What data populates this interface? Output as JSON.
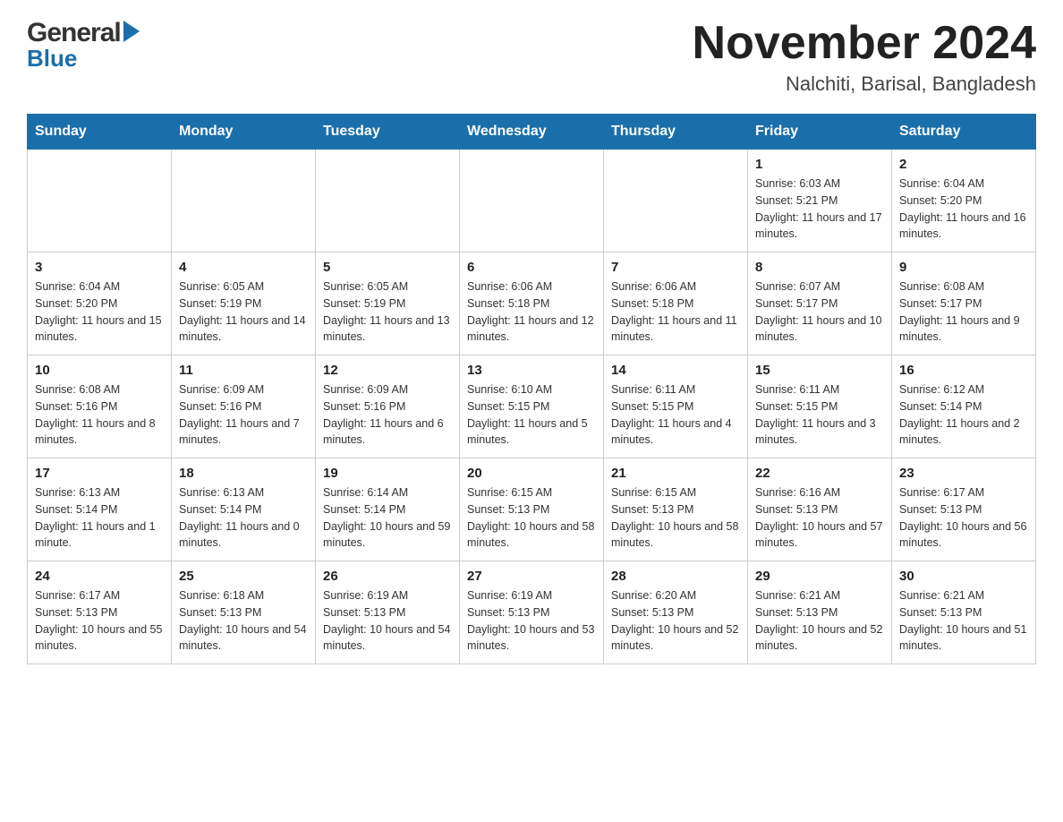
{
  "header": {
    "logo_general": "General",
    "logo_blue": "Blue",
    "month_year": "November 2024",
    "location": "Nalchiti, Barisal, Bangladesh"
  },
  "days_of_week": [
    "Sunday",
    "Monday",
    "Tuesday",
    "Wednesday",
    "Thursday",
    "Friday",
    "Saturday"
  ],
  "weeks": [
    [
      {
        "day": "",
        "sunrise": "",
        "sunset": "",
        "daylight": ""
      },
      {
        "day": "",
        "sunrise": "",
        "sunset": "",
        "daylight": ""
      },
      {
        "day": "",
        "sunrise": "",
        "sunset": "",
        "daylight": ""
      },
      {
        "day": "",
        "sunrise": "",
        "sunset": "",
        "daylight": ""
      },
      {
        "day": "",
        "sunrise": "",
        "sunset": "",
        "daylight": ""
      },
      {
        "day": "1",
        "sunrise": "Sunrise: 6:03 AM",
        "sunset": "Sunset: 5:21 PM",
        "daylight": "Daylight: 11 hours and 17 minutes."
      },
      {
        "day": "2",
        "sunrise": "Sunrise: 6:04 AM",
        "sunset": "Sunset: 5:20 PM",
        "daylight": "Daylight: 11 hours and 16 minutes."
      }
    ],
    [
      {
        "day": "3",
        "sunrise": "Sunrise: 6:04 AM",
        "sunset": "Sunset: 5:20 PM",
        "daylight": "Daylight: 11 hours and 15 minutes."
      },
      {
        "day": "4",
        "sunrise": "Sunrise: 6:05 AM",
        "sunset": "Sunset: 5:19 PM",
        "daylight": "Daylight: 11 hours and 14 minutes."
      },
      {
        "day": "5",
        "sunrise": "Sunrise: 6:05 AM",
        "sunset": "Sunset: 5:19 PM",
        "daylight": "Daylight: 11 hours and 13 minutes."
      },
      {
        "day": "6",
        "sunrise": "Sunrise: 6:06 AM",
        "sunset": "Sunset: 5:18 PM",
        "daylight": "Daylight: 11 hours and 12 minutes."
      },
      {
        "day": "7",
        "sunrise": "Sunrise: 6:06 AM",
        "sunset": "Sunset: 5:18 PM",
        "daylight": "Daylight: 11 hours and 11 minutes."
      },
      {
        "day": "8",
        "sunrise": "Sunrise: 6:07 AM",
        "sunset": "Sunset: 5:17 PM",
        "daylight": "Daylight: 11 hours and 10 minutes."
      },
      {
        "day": "9",
        "sunrise": "Sunrise: 6:08 AM",
        "sunset": "Sunset: 5:17 PM",
        "daylight": "Daylight: 11 hours and 9 minutes."
      }
    ],
    [
      {
        "day": "10",
        "sunrise": "Sunrise: 6:08 AM",
        "sunset": "Sunset: 5:16 PM",
        "daylight": "Daylight: 11 hours and 8 minutes."
      },
      {
        "day": "11",
        "sunrise": "Sunrise: 6:09 AM",
        "sunset": "Sunset: 5:16 PM",
        "daylight": "Daylight: 11 hours and 7 minutes."
      },
      {
        "day": "12",
        "sunrise": "Sunrise: 6:09 AM",
        "sunset": "Sunset: 5:16 PM",
        "daylight": "Daylight: 11 hours and 6 minutes."
      },
      {
        "day": "13",
        "sunrise": "Sunrise: 6:10 AM",
        "sunset": "Sunset: 5:15 PM",
        "daylight": "Daylight: 11 hours and 5 minutes."
      },
      {
        "day": "14",
        "sunrise": "Sunrise: 6:11 AM",
        "sunset": "Sunset: 5:15 PM",
        "daylight": "Daylight: 11 hours and 4 minutes."
      },
      {
        "day": "15",
        "sunrise": "Sunrise: 6:11 AM",
        "sunset": "Sunset: 5:15 PM",
        "daylight": "Daylight: 11 hours and 3 minutes."
      },
      {
        "day": "16",
        "sunrise": "Sunrise: 6:12 AM",
        "sunset": "Sunset: 5:14 PM",
        "daylight": "Daylight: 11 hours and 2 minutes."
      }
    ],
    [
      {
        "day": "17",
        "sunrise": "Sunrise: 6:13 AM",
        "sunset": "Sunset: 5:14 PM",
        "daylight": "Daylight: 11 hours and 1 minute."
      },
      {
        "day": "18",
        "sunrise": "Sunrise: 6:13 AM",
        "sunset": "Sunset: 5:14 PM",
        "daylight": "Daylight: 11 hours and 0 minutes."
      },
      {
        "day": "19",
        "sunrise": "Sunrise: 6:14 AM",
        "sunset": "Sunset: 5:14 PM",
        "daylight": "Daylight: 10 hours and 59 minutes."
      },
      {
        "day": "20",
        "sunrise": "Sunrise: 6:15 AM",
        "sunset": "Sunset: 5:13 PM",
        "daylight": "Daylight: 10 hours and 58 minutes."
      },
      {
        "day": "21",
        "sunrise": "Sunrise: 6:15 AM",
        "sunset": "Sunset: 5:13 PM",
        "daylight": "Daylight: 10 hours and 58 minutes."
      },
      {
        "day": "22",
        "sunrise": "Sunrise: 6:16 AM",
        "sunset": "Sunset: 5:13 PM",
        "daylight": "Daylight: 10 hours and 57 minutes."
      },
      {
        "day": "23",
        "sunrise": "Sunrise: 6:17 AM",
        "sunset": "Sunset: 5:13 PM",
        "daylight": "Daylight: 10 hours and 56 minutes."
      }
    ],
    [
      {
        "day": "24",
        "sunrise": "Sunrise: 6:17 AM",
        "sunset": "Sunset: 5:13 PM",
        "daylight": "Daylight: 10 hours and 55 minutes."
      },
      {
        "day": "25",
        "sunrise": "Sunrise: 6:18 AM",
        "sunset": "Sunset: 5:13 PM",
        "daylight": "Daylight: 10 hours and 54 minutes."
      },
      {
        "day": "26",
        "sunrise": "Sunrise: 6:19 AM",
        "sunset": "Sunset: 5:13 PM",
        "daylight": "Daylight: 10 hours and 54 minutes."
      },
      {
        "day": "27",
        "sunrise": "Sunrise: 6:19 AM",
        "sunset": "Sunset: 5:13 PM",
        "daylight": "Daylight: 10 hours and 53 minutes."
      },
      {
        "day": "28",
        "sunrise": "Sunrise: 6:20 AM",
        "sunset": "Sunset: 5:13 PM",
        "daylight": "Daylight: 10 hours and 52 minutes."
      },
      {
        "day": "29",
        "sunrise": "Sunrise: 6:21 AM",
        "sunset": "Sunset: 5:13 PM",
        "daylight": "Daylight: 10 hours and 52 minutes."
      },
      {
        "day": "30",
        "sunrise": "Sunrise: 6:21 AM",
        "sunset": "Sunset: 5:13 PM",
        "daylight": "Daylight: 10 hours and 51 minutes."
      }
    ]
  ]
}
